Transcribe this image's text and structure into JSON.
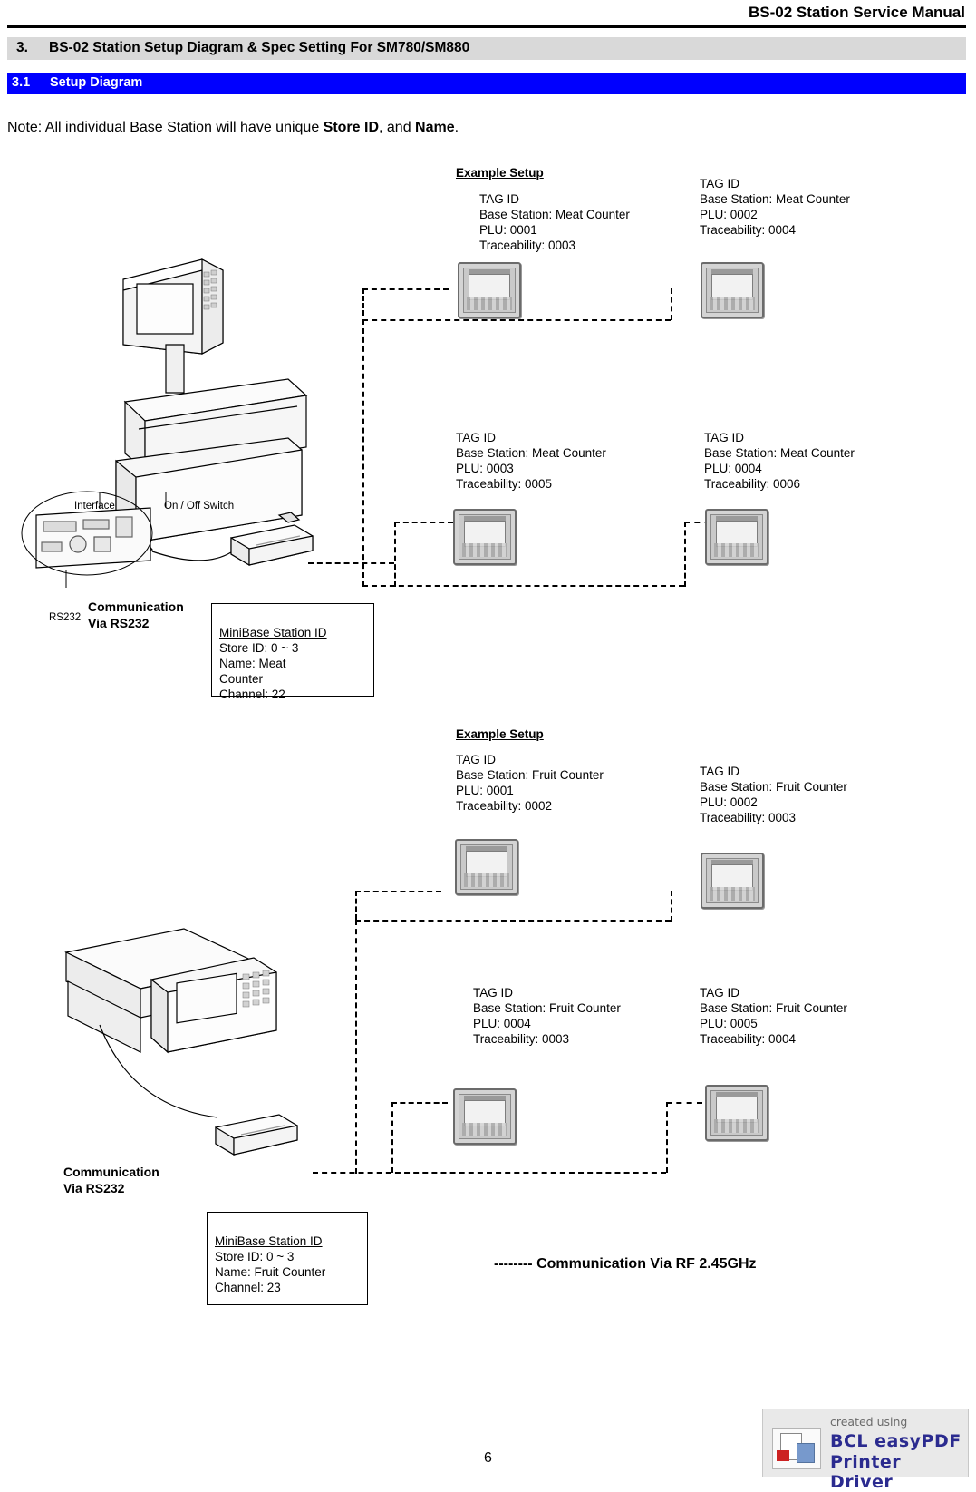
{
  "header": {
    "title": "BS-02 Station Service Manual"
  },
  "sections": {
    "main": {
      "number": "3.",
      "title": "BS-02 Station Setup Diagram & Spec Setting For SM780/SM880"
    },
    "sub": {
      "number": "3.1",
      "title": "Setup Diagram"
    }
  },
  "note": {
    "prefix": "Note: All individual Base Station will have unique ",
    "bold1": "Store ID",
    "middle": ", and ",
    "bold2": "Name",
    "suffix": "."
  },
  "diagram1": {
    "example_label": "Example Setup",
    "tags": [
      {
        "title": "TAG ID",
        "lines": "Base Station: Meat Counter\nPLU: 0001\nTraceability: 0003"
      },
      {
        "title": "TAG ID",
        "lines": "Base Station: Meat Counter\nPLU: 0002\nTraceability: 0004"
      },
      {
        "title": "TAG ID",
        "lines": "Base Station: Meat Counter\nPLU: 0003\nTraceability: 0005"
      },
      {
        "title": "TAG ID",
        "lines": "Base Station: Meat Counter\nPLU: 0004\nTraceability: 0006"
      }
    ],
    "scale_labels": {
      "interface": "Interface",
      "on_off": "On / Off Switch",
      "rs232": "RS232"
    },
    "comm_label": "Communication\nVia RS232",
    "station_box": {
      "title": "MiniBase Station ID",
      "lines": "Store ID: 0 ~ 3\nName: Meat\nCounter\nChannel: 22"
    }
  },
  "diagram2": {
    "example_label": "Example Setup",
    "tags": [
      {
        "title": "TAG ID",
        "lines": "Base Station: Fruit Counter\nPLU: 0001\nTraceability: 0002"
      },
      {
        "title": "TAG ID",
        "lines": "Base Station: Fruit Counter\nPLU: 0002\nTraceability: 0003"
      },
      {
        "title": "TAG ID",
        "lines": "Base Station: Fruit Counter\nPLU: 0004\nTraceability: 0003"
      },
      {
        "title": "TAG ID",
        "lines": "Base Station: Fruit Counter\nPLU: 0005\nTraceability: 0004"
      }
    ],
    "comm_label": "Communication\nVia RS232",
    "station_box": {
      "title": "MiniBase Station ID",
      "lines": "Store ID: 0 ~ 3\nName: Fruit Counter\nChannel: 23"
    }
  },
  "legend": "-------- Communication Via RF 2.45GHz",
  "page_number": "6",
  "watermark": {
    "created": "created using",
    "brand_line1": "BCL easyPDF",
    "brand_line2": "Printer Driver"
  }
}
